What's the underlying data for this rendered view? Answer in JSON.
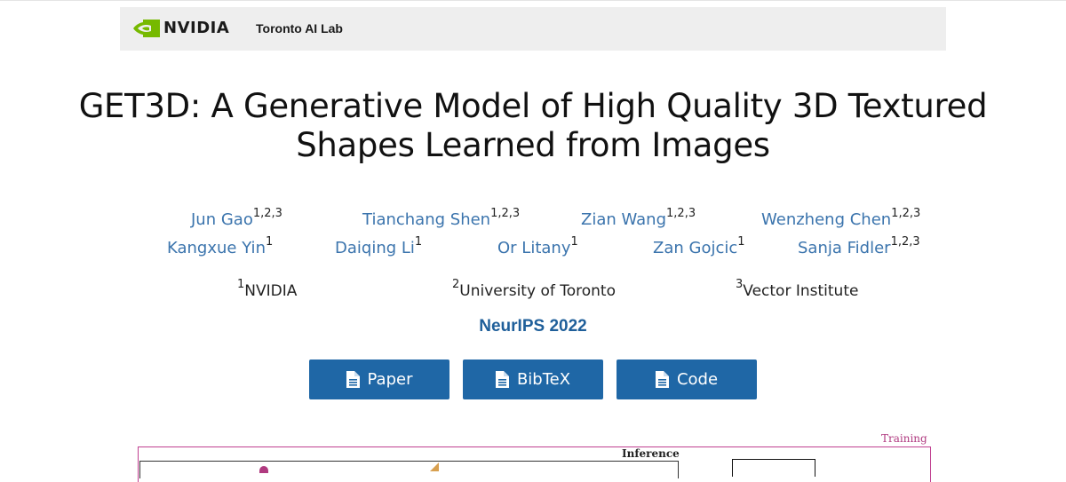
{
  "header": {
    "brand": "NVIDIA",
    "lab": "Toronto AI Lab"
  },
  "title_line1": "GET3D: A Generative Model of High Quality 3D Textured",
  "title_line2": "Shapes Learned from Images",
  "authors": [
    {
      "name": "Jun Gao",
      "aff": "1,2,3"
    },
    {
      "name": "Tianchang Shen",
      "aff": "1,2,3"
    },
    {
      "name": "Zian Wang",
      "aff": "1,2,3"
    },
    {
      "name": "Wenzheng Chen",
      "aff": "1,2,3"
    },
    {
      "name": "Kangxue Yin",
      "aff": "1"
    },
    {
      "name": "Daiqing Li",
      "aff": "1"
    },
    {
      "name": "Or Litany",
      "aff": "1"
    },
    {
      "name": "Zan Gojcic",
      "aff": "1"
    },
    {
      "name": "Sanja Fidler",
      "aff": "1,2,3"
    }
  ],
  "affiliations": [
    {
      "num": "1",
      "name": "NVIDIA"
    },
    {
      "num": "2",
      "name": "University of Toronto"
    },
    {
      "num": "3",
      "name": "Vector Institute"
    }
  ],
  "venue": "NeurIPS 2022",
  "buttons": {
    "paper": "Paper",
    "bibtex": "BibTeX",
    "code": "Code"
  },
  "figure": {
    "inference_label": "Inference",
    "training_label": "Training"
  },
  "colors": {
    "link": "#3b74ad",
    "button": "#1f67a6",
    "nvidia_green": "#76b900"
  }
}
